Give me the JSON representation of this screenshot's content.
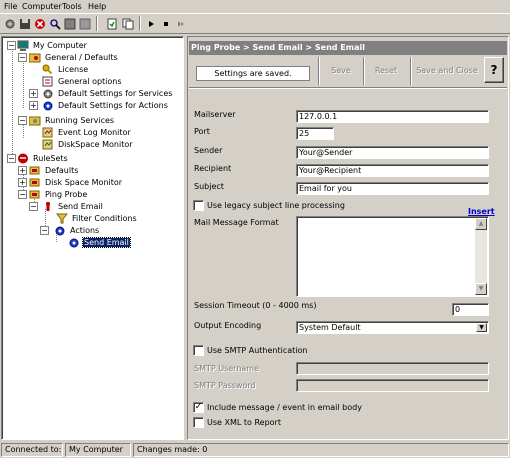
{
  "menu": [
    "File",
    "Computer",
    "Tools",
    "Help"
  ],
  "toolbar": {
    "icons": [
      "gear-icon",
      "save-icon",
      "delete-icon",
      "search-icon",
      "stop-icon",
      "grid-icon",
      "refresh-icon",
      "copy-icon",
      "play-icon",
      "stop-small-icon",
      "pause-icon"
    ]
  },
  "tree": {
    "root": "My Computer",
    "general": "General / Defaults",
    "license": "License",
    "general_options": "General options",
    "default_services": "Default Settings for Services",
    "default_actions": "Default Settings for Actions",
    "running_services": "Running Services",
    "event_log": "Event Log Monitor",
    "diskspace": "DiskSpace Monitor",
    "rulesets": "RuleSets",
    "defaults": "Defaults",
    "disk_space_monitor": "Disk Space Monitor",
    "ping_probe": "Ping Probe",
    "send_email": "Send Email",
    "filter_conditions": "Filter Conditions",
    "actions": "Actions",
    "send_email_action": "Send Email"
  },
  "panel": {
    "title": "Ping Probe > Send Email > Send Email",
    "status": "Settings are saved.",
    "save": "Save",
    "reset": "Reset",
    "save_close": "Save and Close",
    "help": "?"
  },
  "form": {
    "mailserver_label": "Mailserver",
    "mailserver": "127.0.0.1",
    "port_label": "Port",
    "port": "25",
    "sender_label": "Sender",
    "sender": "Your@Sender",
    "recipient_label": "Recipient",
    "recipient": "Your@Recipient",
    "subject_label": "Subject",
    "subject": "Email for you",
    "legacy_label": "Use legacy subject line processing",
    "insert": "Insert",
    "format_label": "Mail Message Format",
    "timeout_label": "Session Timeout (0 - 4000 ms)",
    "timeout": "0",
    "encoding_label": "Output Encoding",
    "encoding": "System Default",
    "smtp_auth_label": "Use SMTP Authentication",
    "smtp_user_label": "SMTP Username",
    "smtp_pass_label": "SMTP Password",
    "include_label": "Include message / event in email body",
    "xml_label": "Use XML to Report",
    "check_mark": "✓"
  },
  "statusbar": {
    "connected_label": "Connected to:",
    "connected_value": "My Computer",
    "changes": "Changes made: 0"
  }
}
